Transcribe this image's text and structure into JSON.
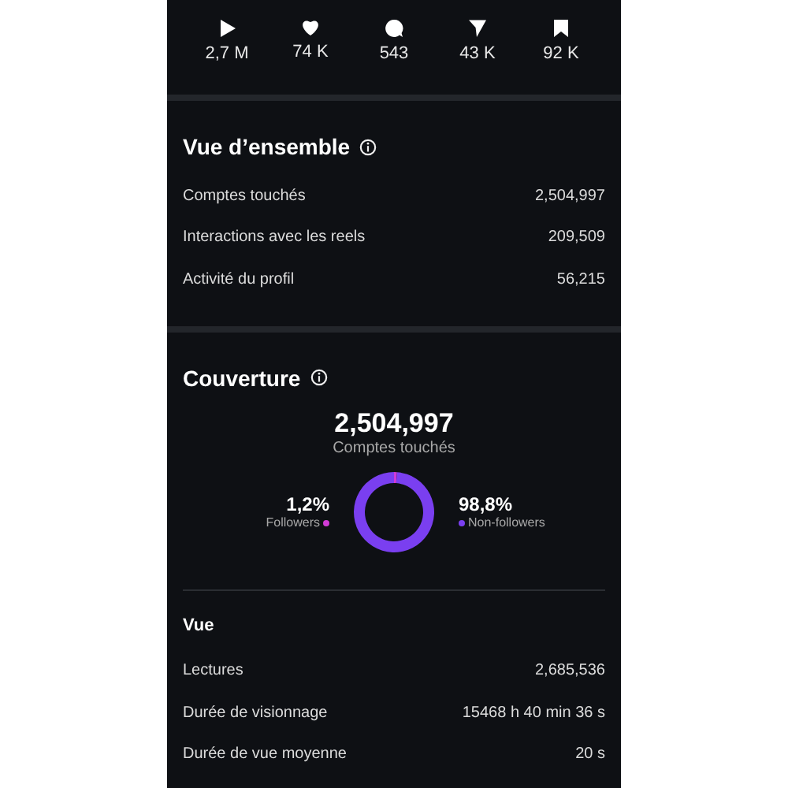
{
  "stats": [
    {
      "kind": "play",
      "value": "2,7 M"
    },
    {
      "kind": "like",
      "value": "74 K"
    },
    {
      "kind": "comment",
      "value": "543"
    },
    {
      "kind": "share",
      "value": "43 K"
    },
    {
      "kind": "save",
      "value": "92 K"
    }
  ],
  "overview": {
    "title": "Vue d’ensemble",
    "rows": [
      {
        "label": "Comptes touchés",
        "value": "2,504,997"
      },
      {
        "label": "Interactions avec les reels",
        "value": "209,509"
      },
      {
        "label": "Activité du profil",
        "value": "56,215"
      }
    ]
  },
  "coverage": {
    "title": "Couverture",
    "total": "2,504,997",
    "total_label": "Comptes touchés",
    "chart_data": {
      "type": "donut",
      "values": [
        1.2,
        98.8
      ]
    },
    "legend": [
      {
        "percent": "1,2%",
        "label": "Followers",
        "color": "#d13bd6"
      },
      {
        "percent": "98,8%",
        "label": "Non-followers",
        "color": "#7a3ff0"
      }
    ]
  },
  "views": {
    "title": "Vue",
    "rows": [
      {
        "label": "Lectures",
        "value": "2,685,536"
      },
      {
        "label": "Durée de visionnage",
        "value": "15468 h 40 min 36 s"
      },
      {
        "label": "Durée de vue moyenne",
        "value": "20 s"
      }
    ]
  }
}
